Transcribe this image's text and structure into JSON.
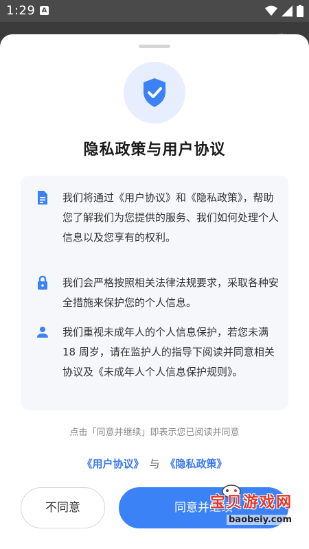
{
  "status_bar": {
    "time": "1:29",
    "notification_badge": "A"
  },
  "behind_page": {
    "text": "实…"
  },
  "sheet": {
    "title": "隐私政策与用户协议",
    "items": [
      {
        "icon": "document-icon",
        "text": "我们将通过《用户协议》和《隐私政策》，帮助您了解我们为您提供的服务、我们如何处理个人信息以及您享有的权利。"
      },
      {
        "icon": "lock-icon",
        "text": "我们会严格按照相关法律法规要求，采取各种安全措施来保护您的个人信息。"
      },
      {
        "icon": "person-icon",
        "text": "我们重视未成年人的个人信息保护，若您未满 18 周岁，请在监护人的指导下阅读并同意相关协议及《未成年人个人信息保护规则》。"
      }
    ],
    "notice": "点击「同意并继续」即表示您已阅读并同意",
    "user_agreement_link": "《用户协议》",
    "and_word": "与",
    "privacy_policy_link": "《隐私政策》",
    "disagree_label": "不同意",
    "agree_label": "同意并继续"
  },
  "watermark": {
    "title": "宝贝游戏网",
    "url": "baobeiy.com"
  },
  "colors": {
    "accent": "#3b82f6",
    "link": "#3a78ef",
    "icon_circle": "#e6eeff",
    "card_bg": "#f5f7fa"
  }
}
